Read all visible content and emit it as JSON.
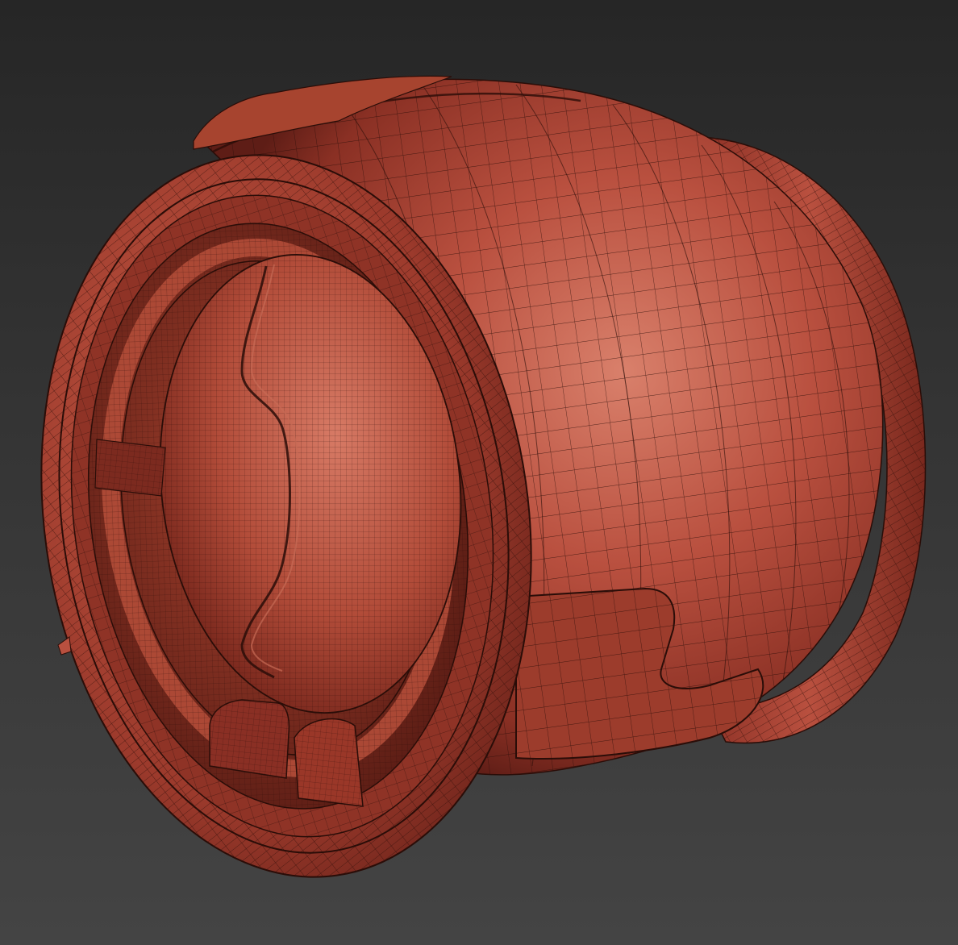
{
  "viewport": {
    "background_top": "#262626",
    "background_bottom": "#444444"
  },
  "model": {
    "subject": "jet-engine-nacelle-wireframe",
    "shading": "wireframe-on-shaded",
    "base_color": "#b84a3c",
    "shadow_color": "#6e241c",
    "highlight_color": "#d4735f",
    "wire_color": "#2a0d08"
  }
}
